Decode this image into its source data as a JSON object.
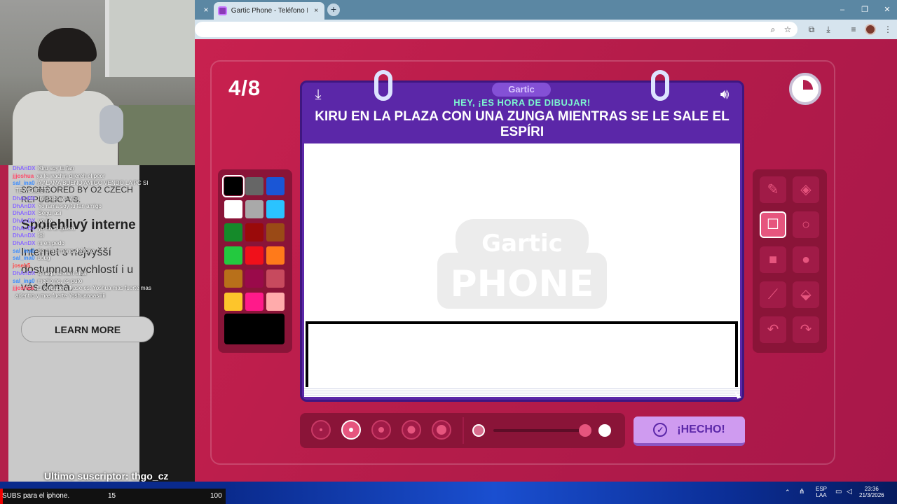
{
  "browser": {
    "tab_title": "Gartic Phone - Teléfono Desco",
    "tab_close": "×",
    "prev_tab_close": "×",
    "new_tab": "+",
    "win_min": "–",
    "win_max": "❐",
    "win_close": "✕"
  },
  "game": {
    "round": "4/8",
    "logo_label": "Gartic",
    "prompt_header": "HEY, ¡ES HORA DE DIBUJAR!",
    "prompt": "KIRU EN LA PLAZA CON UNA ZUNGA MIENTRAS SE LE SALE EL ESPÍRI",
    "watermark_top": "Gartic",
    "watermark_bottom": "PHONE",
    "done_label": "¡HECHO!",
    "palette": [
      "#000000",
      "#666666",
      "#1a56d6",
      "#ffffff",
      "#a9a9a9",
      "#2ac3ff",
      "#158a2a",
      "#9a0a0a",
      "#9a4a16",
      "#23c93f",
      "#f0101a",
      "#ff7a1a",
      "#b8701a",
      "#9a0a4a",
      "#c74a5e",
      "#fdc52b",
      "#ff1a8a",
      "#ffabab"
    ],
    "selected_color": "#000000",
    "tools": [
      "pencil-icon",
      "eraser-icon",
      "rectangle-outline-icon",
      "ellipse-outline-icon",
      "rectangle-fill-icon",
      "ellipse-fill-icon",
      "line-icon",
      "fill-bucket-icon",
      "undo-icon",
      "redo-icon"
    ],
    "selected_tool": "rectangle-outline-icon",
    "selected_brush_size": 2,
    "opacity_level": 1
  },
  "overlay": {
    "chat": [
      {
        "user": "DhAnDX",
        "msg": "Kiru soy tu fan",
        "color": "#8c6cff"
      },
      {
        "user": "jjjoshua",
        "msg": "ya le wachin d jereh el peor",
        "color": "#ff4a6a"
      },
      {
        "user": "sal_ina0",
        "msg": "A ALAMA BUENO AMIGO VENDO LA PC SI",
        "color": "#3a8cff"
      },
      {
        "user": "",
        "msg": "TE MOLESTA",
        "color": "#ffffff"
      },
      {
        "user": "DhAnDX",
        "msg": "Inti bobo yo vico",
        "color": "#8c6cff"
      },
      {
        "user": "DhAnDX",
        "msg": "Yo rama soy tu fan amigo",
        "color": "#8c6cff"
      },
      {
        "user": "DhAnDX",
        "msg": "Segui asi",
        "color": "#8c6cff"
      },
      {
        "user": "DhAnDX",
        "msg": "yo no",
        "color": "#8c6cff"
      },
      {
        "user": "DhAnDX",
        "msg": "yo no te quiero",
        "color": "#8c6cff"
      },
      {
        "user": "DhAnDX",
        "msg": "lol",
        "color": "#8c6cff"
      },
      {
        "user": "DhAnDX",
        "msg": "ni en pedo",
        "color": "#8c6cff"
      },
      {
        "user": "sal_ina0",
        "msg": "de el hermano del loko",
        "color": "#3a8cff"
      },
      {
        "user": "sal_ina0",
        "msg": "doug",
        "color": "#3a8cff"
      },
      {
        "user": "joseh5",
        "msg": "",
        "color": "#ff4a4a"
      },
      {
        "user": "DhAnDX",
        "msg": "q haga stream frida",
        "color": "#8c6cff"
      },
      {
        "user": "sal_ina0",
        "msg": "medio no, es puto",
        "color": "#3a8cff"
      },
      {
        "user": "jjjoshua",
        "msg": "tu verdadera frase es: Yoshua mas fuerte mas",
        "color": "#ff4a6a"
      },
      {
        "user": "",
        "msg": "adentro y mas fuerte Yoshuaaaasiiiii",
        "color": "#ffffff"
      }
    ],
    "ad_lines": [
      "SPONSORED BY O2 CZECH",
      "REPUBLIC A.S.",
      "Spolehlivý interne",
      "Internet s nejvyšší",
      "dostupnou rychlostí i u",
      "vás doma."
    ],
    "learn_more": "LEARN MORE",
    "last_sub_label": "Ultimo suscriptor:",
    "last_sub_name": "thgo_cz",
    "sub_goal_text": "SUBS para el iphone.",
    "sub_current": "15",
    "sub_target": "100"
  },
  "taskbar": {
    "lang_top": "ESP",
    "lang_bottom": "LAA",
    "time": "23:36",
    "date": "21/3/2026"
  }
}
